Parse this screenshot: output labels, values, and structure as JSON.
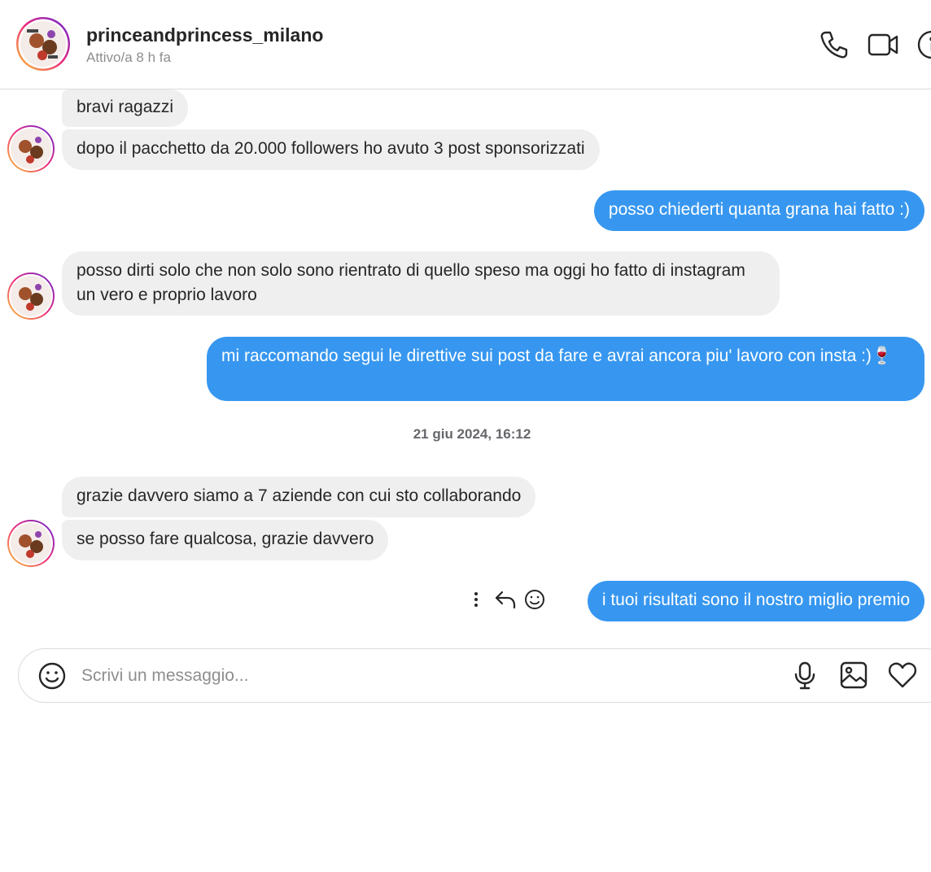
{
  "header": {
    "username": "princeandprincess_milano",
    "status": "Attivo/a 8 h fa",
    "icons": [
      "phone-icon",
      "video-camera-icon",
      "info-icon"
    ]
  },
  "messages": [
    {
      "side": "in",
      "text": "bravi ragazzi"
    },
    {
      "side": "in",
      "text": "dopo il pacchetto da 20.000 followers ho avuto 3 post sponsorizzati"
    },
    {
      "side": "out",
      "text": "posso chiederti quanta grana hai fatto :)"
    },
    {
      "side": "in",
      "text": "posso dirti solo che non solo sono rientrato di quello speso ma oggi ho fatto di instagram un vero e proprio lavoro"
    },
    {
      "side": "out",
      "text": "mi raccomando segui le direttive sui post da fare e avrai ancora piu' lavoro con insta :)🍷"
    },
    {
      "side": "in",
      "text": "grazie davvero siamo a 7 aziende con cui sto collaborando"
    },
    {
      "side": "in",
      "text": "se posso fare qualcosa, grazie davvero"
    },
    {
      "side": "out",
      "text": "i tuoi risultati sono il nostro miglio premio"
    }
  ],
  "timestamp": "21 giu 2024, 16:12",
  "message_actions": [
    "more-options-icon",
    "reply-icon",
    "react-emoji-icon"
  ],
  "composer": {
    "placeholder": "Scrivi un messaggio...",
    "icons": [
      "emoji-icon",
      "microphone-icon",
      "image-icon",
      "heart-icon"
    ]
  },
  "colors": {
    "outgoing_bubble": "#3797f0",
    "incoming_bubble": "#efefef",
    "muted_text": "#8e8e8e"
  }
}
